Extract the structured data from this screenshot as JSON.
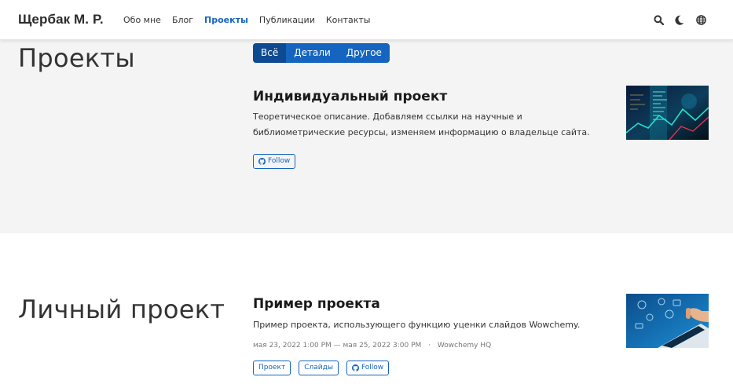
{
  "nav": {
    "brand": "Щербак М. Р.",
    "links": [
      "Обо мне",
      "Блог",
      "Проекты",
      "Публикации",
      "Контакты"
    ],
    "active": "Проекты",
    "accent": "#1565c0"
  },
  "projects_section": {
    "title": "Проекты",
    "filters": [
      "Всё",
      "Детали",
      "Другое"
    ],
    "active_filter": "Всё",
    "project": {
      "title": "Индивидуальный проект",
      "description": "Теоретическое описание. Добавляем ссылки на научные и библиометрические ресурсы, изменяем информацию о владельце сайта.",
      "buttons": [
        "Follow"
      ]
    }
  },
  "personal_section": {
    "title": "Личный проект",
    "project": {
      "title": "Пример проекта",
      "description": "Пример проекта, использующего функцию уценки слайдов Wowchemy.",
      "date_range": "мая 23, 2022 1:00 PM — мая 25, 2022 3:00 PM",
      "location": "Wowchemy HQ",
      "buttons": [
        "Проект",
        "Слайды",
        "Follow"
      ]
    }
  },
  "icons": [
    "search-icon",
    "moon-icon",
    "globe-icon",
    "github-icon"
  ]
}
